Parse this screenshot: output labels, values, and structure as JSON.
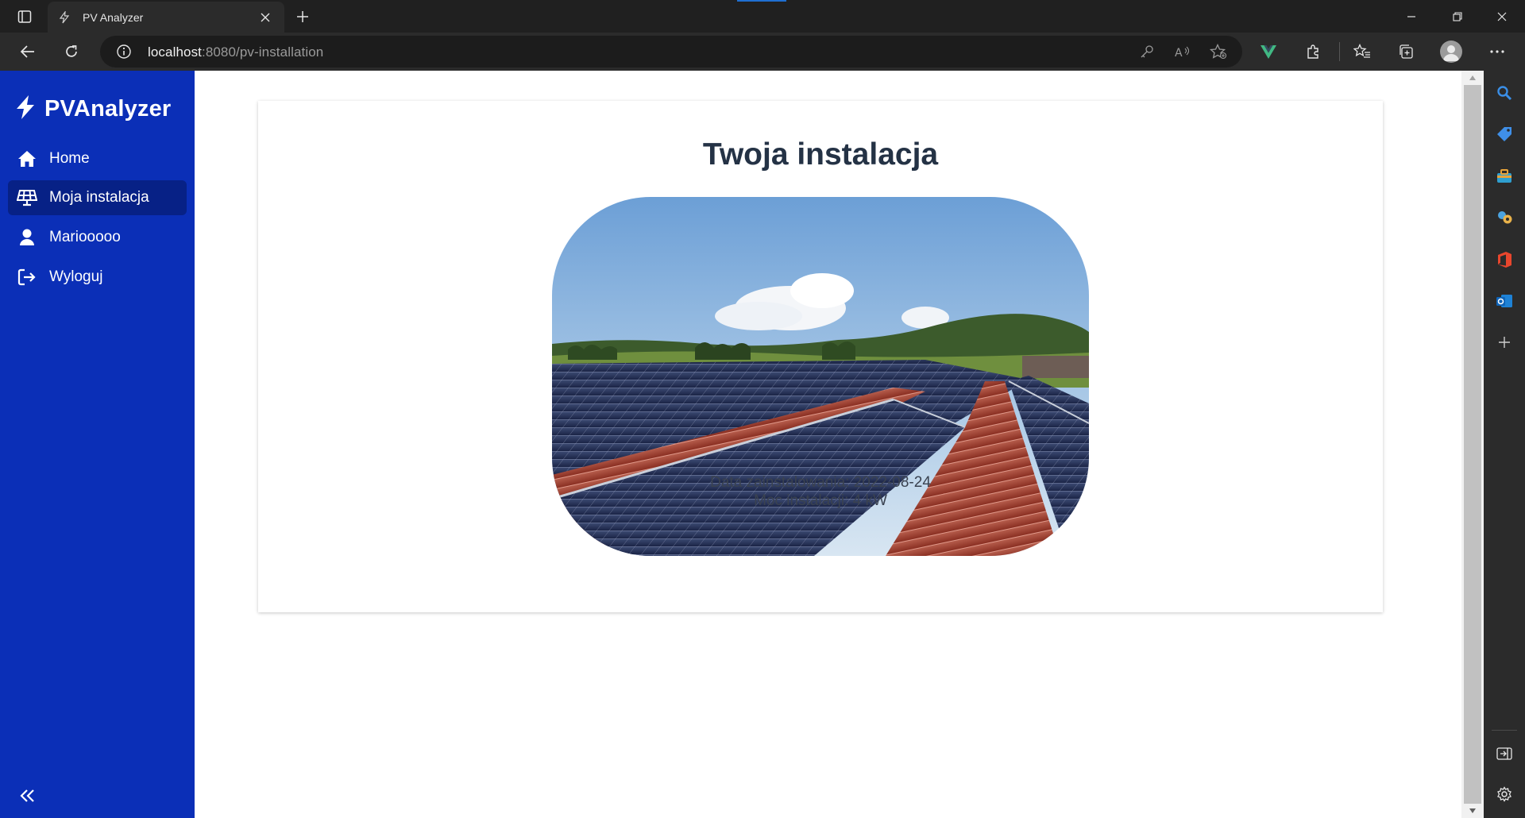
{
  "browser": {
    "tab_title": "PV Analyzer",
    "url_host": "localhost",
    "url_rest": ":8080/pv-installation"
  },
  "app": {
    "brand": "PVAnalyzer",
    "nav": [
      {
        "label": "Home",
        "icon": "home-icon",
        "active": false
      },
      {
        "label": "Moja instalacja",
        "icon": "solar-panel-icon",
        "active": true
      },
      {
        "label": "Mariooooo",
        "icon": "user-icon",
        "active": false
      },
      {
        "label": "Wyloguj",
        "icon": "logout-icon",
        "active": false
      }
    ],
    "colors": {
      "sidebar": "#0b2fb7",
      "sidebar_active": "#072186",
      "title": "#243245"
    }
  },
  "installation": {
    "title": "Twoja instalacja",
    "install_date": "Data zainstalowania: 2022-08-24",
    "power": "Moc instalacji: 4 kW",
    "photo_alt": "solar-panels-photo"
  }
}
